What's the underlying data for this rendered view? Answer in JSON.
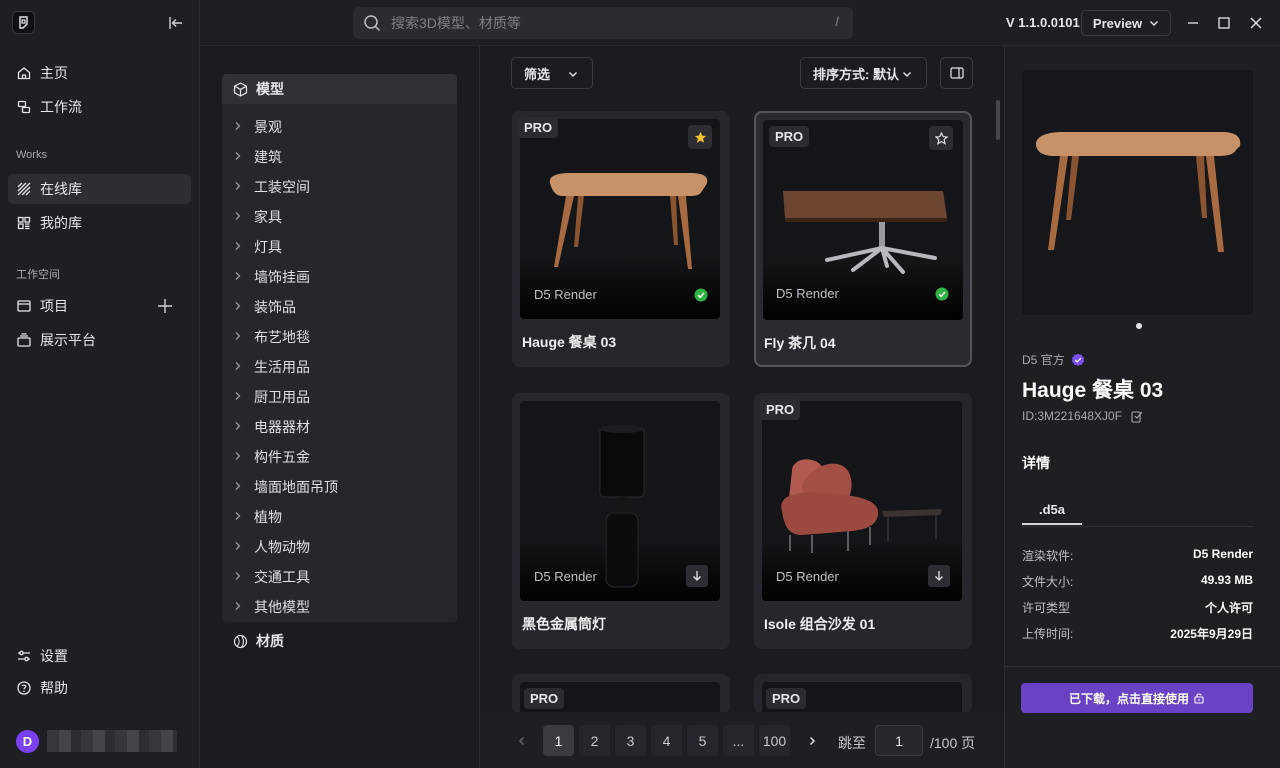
{
  "topbar": {
    "search_placeholder": "搜索3D模型、材质等",
    "search_shortcut": "/",
    "version": "V 1.1.0.0101",
    "preview_label": "Preview"
  },
  "nav": {
    "home": "主页",
    "workflow": "工作流",
    "section_works": "Works",
    "online_library": "在线库",
    "my_library": "我的库",
    "section_workspace": "工作空间",
    "projects": "项目",
    "showcase": "展示平台",
    "settings": "设置",
    "help": "帮助",
    "avatar_letter": "D"
  },
  "categories": {
    "header": "模型",
    "items": [
      "景观",
      "建筑",
      "工装空间",
      "家具",
      "灯具",
      "墙饰挂画",
      "装饰品",
      "布艺地毯",
      "生活用品",
      "厨卫用品",
      "电器器材",
      "构件五金",
      "墙面地面吊顶",
      "植物",
      "人物动物",
      "交通工具",
      "其他模型"
    ],
    "materials": "材质"
  },
  "toolbar": {
    "filter_label": "筛选",
    "sort_label": "排序方式: 默认"
  },
  "cards": [
    {
      "pro": "PRO",
      "brand": "D5 Render",
      "name": "Hauge 餐桌 03"
    },
    {
      "pro": "PRO",
      "brand": "D5 Render",
      "name": "Fly 茶几 04"
    },
    {
      "brand": "D5 Render",
      "name": "黑色金属筒灯"
    },
    {
      "pro": "PRO",
      "brand": "D5 Render",
      "name": "Isole 组合沙发 01"
    },
    {
      "pro": "PRO"
    },
    {
      "pro": "PRO"
    }
  ],
  "pagination": {
    "pages": [
      "1",
      "2",
      "3",
      "4",
      "5",
      "...",
      "100"
    ],
    "jump_label": "跳至",
    "jump_value": "1",
    "total_label": "/100 页"
  },
  "detail": {
    "author": "D5 官方",
    "title": "Hauge 餐桌 03",
    "id": "ID:3M221648XJ0F",
    "section": "详情",
    "format_tab": ".d5a",
    "rows": [
      {
        "k": "渲染软件:",
        "v": "D5 Render"
      },
      {
        "k": "文件大小:",
        "v": "49.93 MB"
      },
      {
        "k": "许可类型",
        "v": "个人许可"
      },
      {
        "k": "上传时间:",
        "v": "2025年9月29日"
      }
    ],
    "use_button": "已下载，点击直接使用"
  },
  "colors": {
    "accent": "#6a42c4",
    "avatar": "#7b3ff2",
    "success": "#2fb344",
    "star": "#f2c12e"
  }
}
